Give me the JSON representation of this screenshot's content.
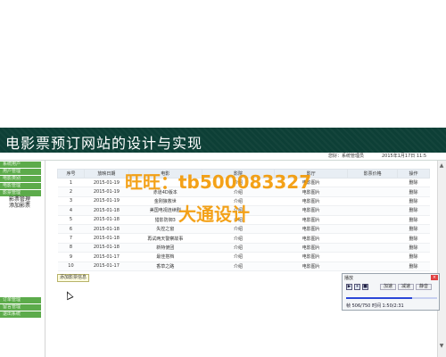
{
  "page": {
    "title": "电影票预订网站的设计与实现"
  },
  "infobar": {
    "role": "您好：系统管理员",
    "datetime": "2015年1月17日 11:5"
  },
  "sidebar": {
    "top_items": [
      "系统用户",
      "用户管理",
      "电影类别",
      "电影管理",
      "影票管理"
    ],
    "sub_items": [
      "影票管理",
      "添加影票"
    ],
    "bottom_items": [
      "订单管理",
      "留言管理",
      "退出系统"
    ]
  },
  "table": {
    "headers": [
      "序号",
      "放映日期",
      "电影",
      "影院",
      "影厅",
      "影票价格",
      "操作"
    ],
    "rows": [
      [
        "1",
        "2015-01-19",
        "",
        "介绍",
        "电影图片",
        "",
        "删除"
      ],
      [
        "2",
        "2015-01-19",
        "赤道4D版本",
        "介绍",
        "电影图片",
        "",
        "删除"
      ],
      [
        "3",
        "2015-01-19",
        "金刚狼救世",
        "介绍",
        "电影图片",
        "",
        "删除"
      ],
      [
        "4",
        "2015-01-18",
        "美国电视连续剧",
        "介绍",
        "电影图片",
        "",
        "删除"
      ],
      [
        "5",
        "2015-01-18",
        "猎影防御3",
        "介绍",
        "电影图片",
        "",
        "删除"
      ],
      [
        "6",
        "2015-01-18",
        "失控之窗",
        "介绍",
        "电影图片",
        "",
        "删除"
      ],
      [
        "7",
        "2015-01-18",
        "再试两天警察故事",
        "介绍",
        "电影图片",
        "",
        "删除"
      ],
      [
        "8",
        "2015-01-18",
        "新特使团",
        "介绍",
        "电影图片",
        "",
        "删除"
      ],
      [
        "9",
        "2015-01-17",
        "最佳搭档",
        "介绍",
        "电影图片",
        "",
        "删除"
      ],
      [
        "10",
        "2015-01-17",
        "香草之路",
        "介绍",
        "电影图片",
        "",
        "删除"
      ]
    ]
  },
  "add_button": "添加影票信息",
  "watermark": {
    "line1": "旺旺：tb500083327",
    "line2": "大通设计"
  },
  "player": {
    "title": "播放",
    "controls": [
      "▶",
      "⏸",
      "■"
    ],
    "btn_fwd": "加速",
    "btn_rwd": "减速",
    "btn_mute": "静音",
    "close": "×",
    "progress": 0.73,
    "status": "帧 506/750 时间 1:50/2:31"
  },
  "colors": {
    "banner": "#0d3f36",
    "sidebar_btn": "#5cab4b",
    "watermark": "#f39800"
  }
}
